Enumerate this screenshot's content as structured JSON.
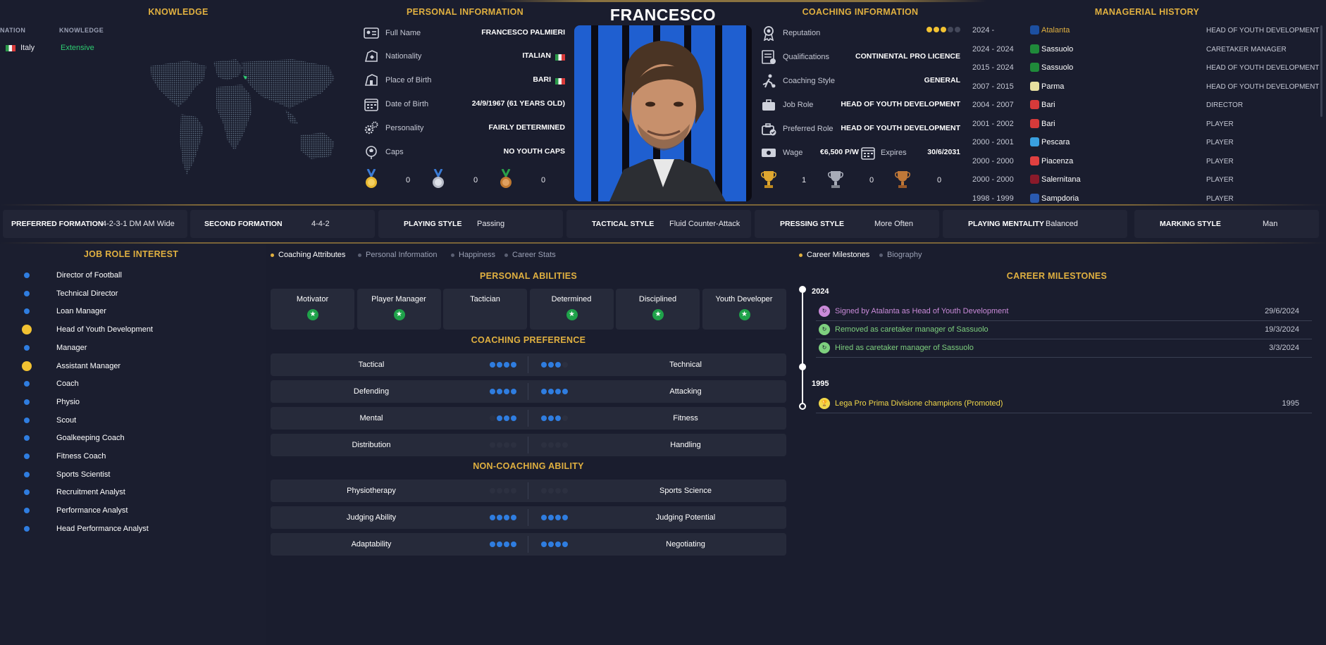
{
  "knowledge": {
    "title": "KNOWLEDGE",
    "col_nation": "NATION",
    "col_knowledge": "KNOWLEDGE",
    "nation": "Italy",
    "level": "Extensive"
  },
  "personal": {
    "title": "PERSONAL INFORMATION",
    "rows": [
      {
        "label": "Full Name",
        "value": "FRANCESCO PALMIERI"
      },
      {
        "label": "Nationality",
        "value": "ITALIAN"
      },
      {
        "label": "Place of Birth",
        "value": "BARI"
      },
      {
        "label": "Date of Birth",
        "value": "24/9/1967 (61 YEARS OLD)"
      },
      {
        "label": "Personality",
        "value": "FAIRLY DETERMINED"
      },
      {
        "label": "Caps",
        "value": "NO YOUTH CAPS"
      }
    ],
    "medals": {
      "gold": "0",
      "silver": "0",
      "bronze": "0"
    }
  },
  "name": "FRANCESCO PALMIERI",
  "coaching": {
    "title": "COACHING INFORMATION",
    "reputation_label": "Reputation",
    "reputation_stars": 3,
    "reputation_max": 5,
    "rows": [
      {
        "label": "Qualifications",
        "value": "CONTINENTAL PRO LICENCE"
      },
      {
        "label": "Coaching Style",
        "value": "GENERAL"
      },
      {
        "label": "Job Role",
        "value": "HEAD OF YOUTH DEVELOPMENT"
      },
      {
        "label": "Preferred Role",
        "value": "HEAD OF YOUTH DEVELOPMENT"
      }
    ],
    "wage_label": "Wage",
    "wage": "€6,500 P/W",
    "expires_label": "Expires",
    "expires": "30/6/2031",
    "trophies": {
      "gold": "1",
      "silver": "0",
      "bronze": "0"
    }
  },
  "history": {
    "title": "MANAGERIAL HISTORY",
    "rows": [
      {
        "years": "2024 -",
        "club": "Atalanta",
        "role": "HEAD OF YOUTH DEVELOPMENT",
        "badge": "#1c4fa0",
        "highlight": true
      },
      {
        "years": "2024 - 2024",
        "club": "Sassuolo",
        "role": "CARETAKER MANAGER",
        "badge": "#1f8a3a"
      },
      {
        "years": "2015 - 2024",
        "club": "Sassuolo",
        "role": "HEAD OF YOUTH DEVELOPMENT",
        "badge": "#1f8a3a"
      },
      {
        "years": "2007 - 2015",
        "club": "Parma",
        "role": "HEAD OF YOUTH DEVELOPMENT",
        "badge": "#e8e0a0"
      },
      {
        "years": "2004 - 2007",
        "club": "Bari",
        "role": "DIRECTOR",
        "badge": "#d63a3a"
      },
      {
        "years": "2001 - 2002",
        "club": "Bari",
        "role": "PLAYER",
        "badge": "#d63a3a"
      },
      {
        "years": "2000 - 2001",
        "club": "Pescara",
        "role": "PLAYER",
        "badge": "#3aa0e0"
      },
      {
        "years": "2000 - 2000",
        "club": "Piacenza",
        "role": "PLAYER",
        "badge": "#e04040"
      },
      {
        "years": "2000 - 2000",
        "club": "Salernitana",
        "role": "PLAYER",
        "badge": "#8a1a2a"
      },
      {
        "years": "1998 - 1999",
        "club": "Sampdoria",
        "role": "PLAYER",
        "badge": "#2a5ab0"
      }
    ]
  },
  "tactics": [
    {
      "label": "PREFERRED FORMATION",
      "value": "4-2-3-1 DM AM Wide"
    },
    {
      "label": "SECOND FORMATION",
      "value": "4-4-2"
    },
    {
      "label": "PLAYING STYLE",
      "value": "Passing"
    },
    {
      "label": "TACTICAL STYLE",
      "value": "Fluid Counter-Attack"
    },
    {
      "label": "PRESSING STYLE",
      "value": "More Often"
    },
    {
      "label": "PLAYING MENTALITY",
      "value": "Balanced"
    },
    {
      "label": "MARKING STYLE",
      "value": "Man"
    }
  ],
  "job_roles": {
    "title": "JOB ROLE INTEREST",
    "items": [
      {
        "name": "Director of Football",
        "big": false
      },
      {
        "name": "Technical Director",
        "big": false
      },
      {
        "name": "Loan Manager",
        "big": false
      },
      {
        "name": "Head of Youth Development",
        "big": true
      },
      {
        "name": "Manager",
        "big": false
      },
      {
        "name": "Assistant Manager",
        "big": true
      },
      {
        "name": "Coach",
        "big": false
      },
      {
        "name": "Physio",
        "big": false
      },
      {
        "name": "Scout",
        "big": false
      },
      {
        "name": "Goalkeeping Coach",
        "big": false
      },
      {
        "name": "Fitness Coach",
        "big": false
      },
      {
        "name": "Sports Scientist",
        "big": false
      },
      {
        "name": "Recruitment Analyst",
        "big": false
      },
      {
        "name": "Performance Analyst",
        "big": false
      },
      {
        "name": "Head Performance Analyst",
        "big": false
      }
    ]
  },
  "tabs_left": [
    "Coaching Attributes",
    "Personal Information",
    "Happiness",
    "Career Stats"
  ],
  "tabs_right": [
    "Career Milestones",
    "Biography"
  ],
  "abilities": {
    "title": "PERSONAL ABILITIES",
    "items": [
      {
        "name": "Motivator",
        "star": true
      },
      {
        "name": "Player Manager",
        "star": true
      },
      {
        "name": "Tactician",
        "star": false
      },
      {
        "name": "Determined",
        "star": true
      },
      {
        "name": "Disciplined",
        "star": true
      },
      {
        "name": "Youth Developer",
        "star": true
      }
    ]
  },
  "coach_pref": {
    "title": "COACHING PREFERENCE",
    "rows": [
      {
        "left": "Tactical",
        "right": "Technical",
        "l": 4,
        "r": 3
      },
      {
        "left": "Defending",
        "right": "Attacking",
        "l": 4,
        "r": 4
      },
      {
        "left": "Mental",
        "right": "Fitness",
        "l": 3,
        "r": 3
      },
      {
        "left": "Distribution",
        "right": "Handling",
        "l": 0,
        "r": 0
      }
    ]
  },
  "non_coach": {
    "title": "NON-COACHING ABILITY",
    "rows": [
      {
        "left": "Physiotherapy",
        "right": "Sports Science",
        "l": 0,
        "r": 0
      },
      {
        "left": "Judging Ability",
        "right": "Judging Potential",
        "l": 4,
        "r": 4
      },
      {
        "left": "Adaptability",
        "right": "Negotiating",
        "l": 4,
        "r": 4
      }
    ]
  },
  "milestones": {
    "title": "CAREER MILESTONES",
    "groups": [
      {
        "year": "2024",
        "items": [
          {
            "text": "Signed by Atalanta as Head of Youth Development",
            "date": "29/6/2024",
            "color": "#c98ad8"
          },
          {
            "text": "Removed as caretaker manager of Sassuolo",
            "date": "19/3/2024",
            "color": "#7ed07e"
          },
          {
            "text": "Hired as caretaker manager of Sassuolo",
            "date": "3/3/2024",
            "color": "#7ed07e"
          }
        ]
      },
      {
        "year": "1995",
        "items": [
          {
            "text": "Lega Pro Prima Divisione champions (Promoted)",
            "date": "1995",
            "color": "#f2d84a"
          }
        ]
      }
    ]
  }
}
